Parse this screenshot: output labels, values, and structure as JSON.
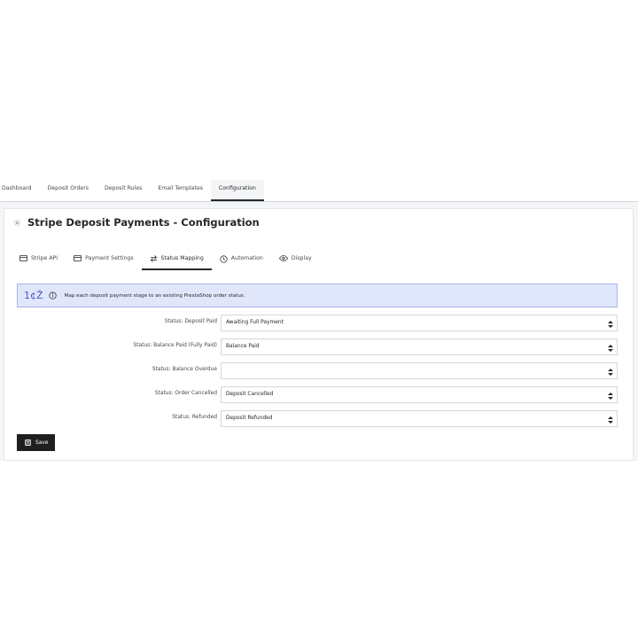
{
  "top_tabs": [
    {
      "label": "Dashboard",
      "active": false
    },
    {
      "label": "Deposit Orders",
      "active": false
    },
    {
      "label": "Deposit Rules",
      "active": false
    },
    {
      "label": "Email Templates",
      "active": false
    },
    {
      "label": "Configuration",
      "active": true
    }
  ],
  "card": {
    "icon": "gear-icon",
    "title": "Stripe Deposit Payments - Configuration"
  },
  "sub_tabs": [
    {
      "label": "Stripe API",
      "icon": "credit-card-icon",
      "active": false
    },
    {
      "label": "Payment Settings",
      "icon": "credit-card-icon",
      "active": false
    },
    {
      "label": "Status Mapping",
      "icon": "swap-arrows-icon",
      "active": true
    },
    {
      "label": "Automation",
      "icon": "clock-icon",
      "active": false
    },
    {
      "label": "Display",
      "icon": "eye-icon",
      "active": false
    }
  ],
  "alert": {
    "glyph": "1¢Ž",
    "icon": "info-icon",
    "message": "Map each deposit payment stage to an existing PrestaShop order status."
  },
  "status_fields": [
    {
      "label": "Status: Deposit Paid",
      "value": "Awaiting Full Payment"
    },
    {
      "label": "Status: Balance Paid (Fully Paid)",
      "value": "Balance Paid"
    },
    {
      "label": "Status: Balance Overdue",
      "value": ""
    },
    {
      "label": "Status: Order Cancelled",
      "value": "Deposit Cancelled"
    },
    {
      "label": "Status: Refunded",
      "value": "Deposit Refunded"
    }
  ],
  "save_button": {
    "label": "Save",
    "icon": "save-disk-icon"
  },
  "colors": {
    "page_bg": "#f4f5f6",
    "alert_bg": "#e1e7fb",
    "alert_border": "#a8b5ea",
    "accent_dark": "#1d1f21"
  }
}
